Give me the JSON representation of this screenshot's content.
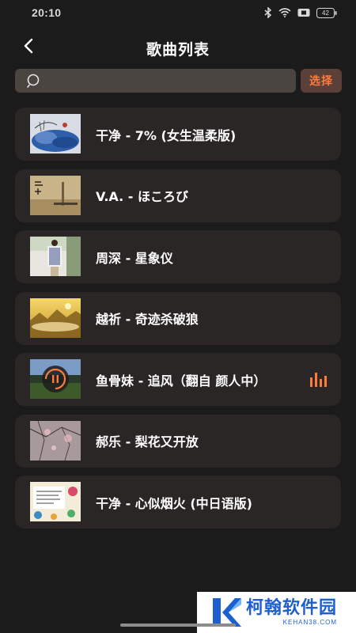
{
  "status_bar": {
    "time": "20:10",
    "battery": "42"
  },
  "header": {
    "title": "歌曲列表",
    "back_icon": "chevron-left-icon"
  },
  "search": {
    "placeholder": "",
    "value": "",
    "icon": "search-icon",
    "select_label": "选择"
  },
  "songs": [
    {
      "title": "干净 - 7% (女生温柔版)",
      "cover": "cover-1",
      "playing": false
    },
    {
      "title": "V.A. - ほころび",
      "cover": "cover-2",
      "playing": false
    },
    {
      "title": "周深 - 星象仪",
      "cover": "cover-3",
      "playing": false
    },
    {
      "title": "越祈 - 奇迹杀破狼",
      "cover": "cover-4",
      "playing": false
    },
    {
      "title": "鱼骨妹 - 追风（翻自 颜人中）",
      "cover": "cover-5",
      "playing": true
    },
    {
      "title": "郝乐 - 梨花又开放",
      "cover": "cover-6",
      "playing": false
    },
    {
      "title": "干净 - 心似烟火 (中日语版)",
      "cover": "cover-7",
      "playing": false
    }
  ],
  "colors": {
    "background": "#1c1b1b",
    "card": "#292625",
    "accent": "#ff7a3d",
    "search_bg": "#4b4542"
  },
  "watermark": {
    "name": "柯翰软件园",
    "url": "KEHAN38.COM"
  }
}
